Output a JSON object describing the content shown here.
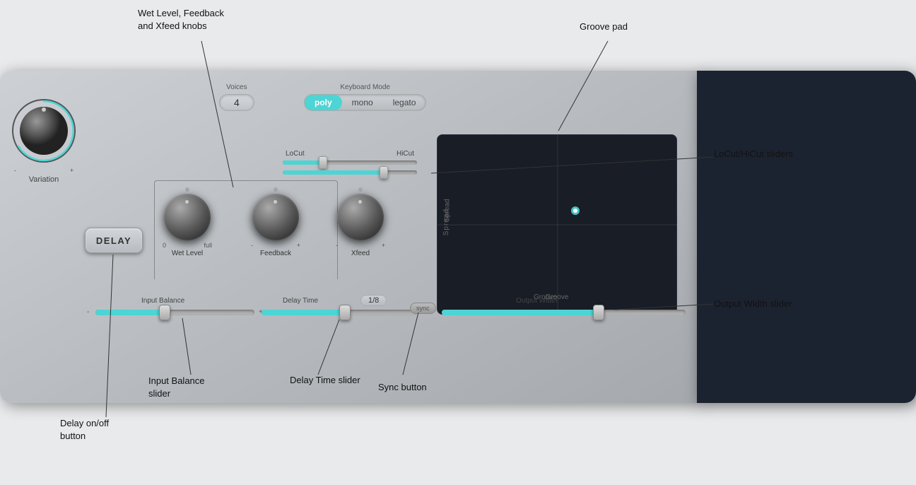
{
  "annotations": {
    "wet_feedback_xfeed": "Wet Level, Feedback\nand Xfeed knobs",
    "groove_pad": "Groove pad",
    "locut_hicut": "LoCut/HiCut sliders",
    "output_width": "Output Width slider",
    "input_balance_slider": "Input Balance\nslider",
    "delay_time_slider": "Delay Time\nslider",
    "sync_button": "Sync button",
    "delay_onoff": "Delay on/off\nbutton"
  },
  "controls": {
    "voices_label": "Voices",
    "voices_value": "4",
    "keyboard_mode_label": "Keyboard Mode",
    "keyboard_modes": [
      "poly",
      "mono",
      "legato"
    ],
    "active_mode": "poly",
    "locut_label": "LoCut",
    "hicut_label": "HiCut",
    "wet_level_label": "Wet Level",
    "wet_level_range_min": "0",
    "wet_level_range_max": "full",
    "feedback_label": "Feedback",
    "feedback_range_min": "-",
    "feedback_range_max": "+",
    "xfeed_label": "Xfeed",
    "xfeed_range_min": "-",
    "xfeed_range_max": "+",
    "input_balance_label": "Input Balance",
    "delay_time_label": "Delay Time",
    "delay_time_value": "1/8",
    "output_width_label": "Output Width",
    "sync_label": "sync",
    "delay_button_label": "DELAY",
    "variation_label": "Variation",
    "spread_label": "Spread",
    "groove_label": "Groove"
  },
  "colors": {
    "accent": "#4dd4d4",
    "dark_panel": "#1c2330",
    "knob_body": "#444",
    "slider_fill": "#4dd4d4"
  }
}
